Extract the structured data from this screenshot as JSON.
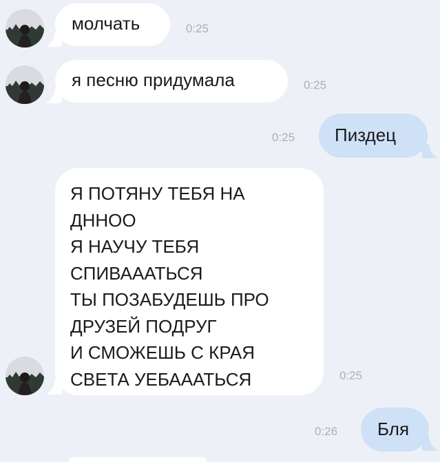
{
  "colors": {
    "background": "#edf1f7",
    "incoming_bubble": "#ffffff",
    "outgoing_bubble": "#cfe1f6",
    "timestamp": "#a9b0b9"
  },
  "messages": [
    {
      "direction": "incoming",
      "text": "молчать",
      "time": "0:25",
      "avatar": "user-avatar-icon"
    },
    {
      "direction": "incoming",
      "text": "я песню придумала",
      "time": "0:25",
      "avatar": "user-avatar-icon"
    },
    {
      "direction": "outgoing",
      "text": "Пиздец",
      "time": "0:25"
    },
    {
      "direction": "incoming",
      "text": "Я ПОТЯНУ ТЕБЯ НА\nДННОО\nЯ НАУЧУ ТЕБЯ\nСПИВАААТЬСЯ\nТЫ ПОЗАБУДЕШЬ ПРО\nДРУЗЕЙ ПОДРУГ\nИ СМОЖЕШЬ С КРАЯ\nСВЕТА УЕБАААТЬСЯ",
      "time": "0:25",
      "avatar": "user-avatar-icon"
    },
    {
      "direction": "outgoing",
      "text": "Бля",
      "time": "0:26"
    }
  ]
}
